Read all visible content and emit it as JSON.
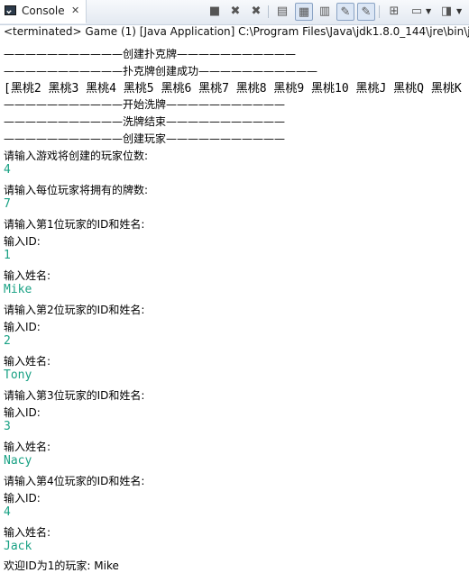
{
  "tab": {
    "label": "Console",
    "close": "✕"
  },
  "toolbar": {
    "icons": [
      "terminate-icon",
      "remove-launch-icon",
      "remove-all-icon",
      "scroll-lock-icon",
      "word-wrap-icon",
      "show-on-stdout-icon",
      "show-on-stderr-icon",
      "pin-console-icon",
      "display-selected-console-icon",
      "open-console-icon"
    ]
  },
  "status": "<terminated> Game (1) [Java Application] C:\\Program Files\\Java\\jdk1.8.0_144\\jre\\bin\\java",
  "lines": [
    "———————————创建扑克牌———————————",
    "———————————扑克牌创建成功———————————",
    "[黑桃2 黑桃3 黑桃4 黑桃5 黑桃6 黑桃7 黑桃8 黑桃9 黑桃10 黑桃J 黑桃Q 黑桃K",
    "———————————开始洗牌———————————",
    "———————————洗牌结束———————————",
    "———————————创建玩家———————————",
    "请输入游戏将创建的玩家位数:",
    "4",
    "请输入每位玩家将拥有的牌数:",
    "7",
    "请输入第1位玩家的ID和姓名:",
    "输入ID:",
    "1",
    "输入姓名:",
    "Mike",
    "请输入第2位玩家的ID和姓名:",
    "输入ID:",
    "2",
    "输入姓名:",
    "Tony",
    "请输入第3位玩家的ID和姓名:",
    "输入ID:",
    "3",
    "输入姓名:",
    "Nacy",
    "请输入第4位玩家的ID和姓名:",
    "输入ID:",
    "4",
    "输入姓名:",
    "Jack",
    "欢迎ID为1的玩家: Mike"
  ]
}
